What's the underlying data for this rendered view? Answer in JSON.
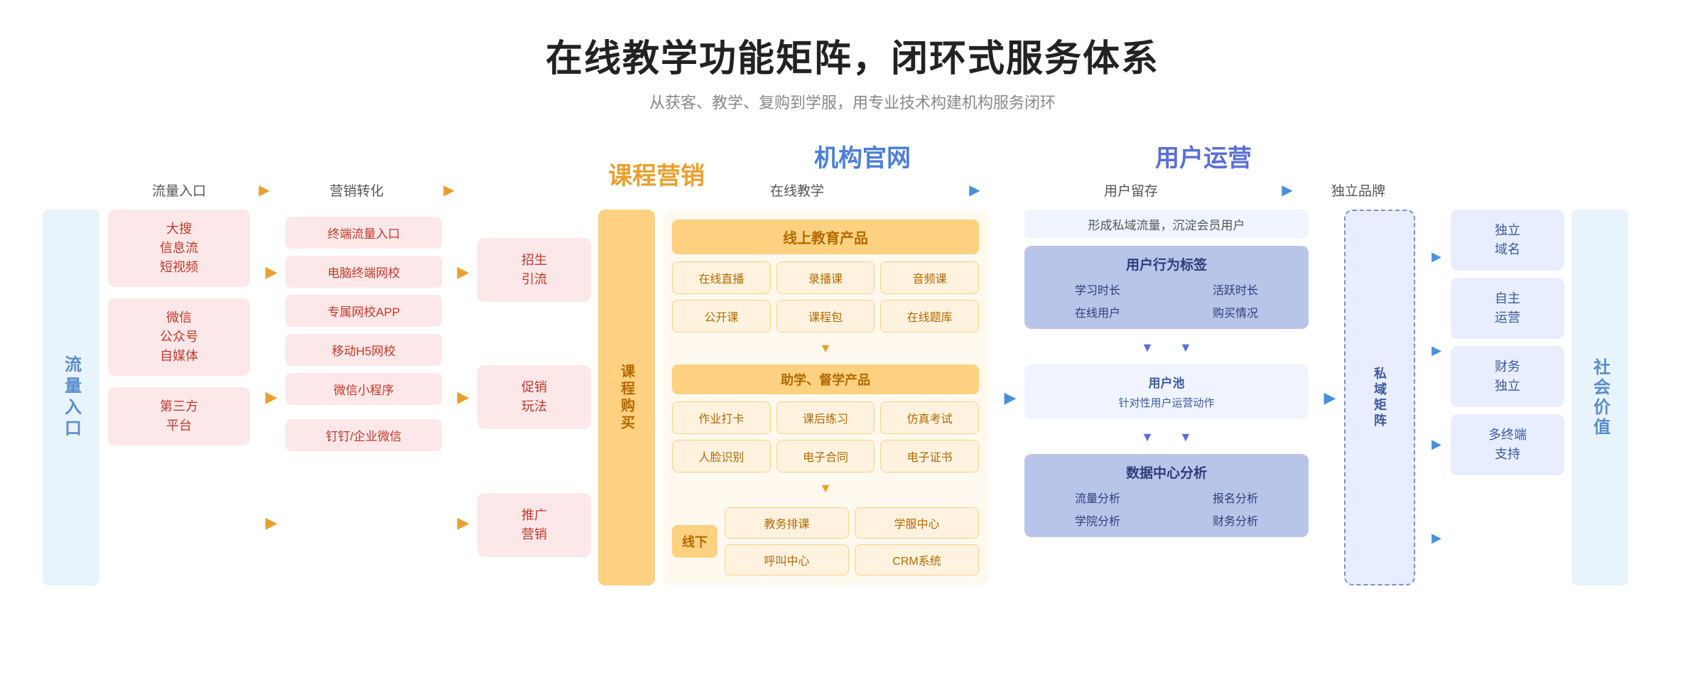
{
  "header": {
    "title": "在线教学功能矩阵，闭环式服务体系",
    "subtitle": "从获客、教学、复购到学服，用专业技术构建机构服务闭环"
  },
  "categories": {
    "marketing": "课程营销",
    "official": "机构官网",
    "user_ops": "用户运营"
  },
  "flow_labels": {
    "traffic_entry": "流量入口",
    "arrow1": "▶",
    "marketing_conv": "营销转化",
    "arrow2": "▶",
    "online_teaching": "在线教学",
    "arrow3": "▶",
    "user_retain": "用户留存",
    "arrow4": "▶",
    "brand": "独立品牌"
  },
  "left_label": "流量入口",
  "right_label": "社会价值",
  "traffic_sources": [
    "大搜\n信息流\n短视频",
    "微信\n公众号\n自媒体",
    "第三方\n平台"
  ],
  "mkt_items_col1": [
    "终端流量入口",
    "电脑终端网校",
    "专属网校APP",
    "移动H5网校",
    "微信小程序",
    "钉钉/企业微信"
  ],
  "mkt_items_groups": {
    "group1": [
      "终端流量入口"
    ],
    "group2": [
      "电脑终端网校",
      "专属网校APP",
      "移动H5网校",
      "微信小程序"
    ],
    "group3": [
      "钉钉/企业微信"
    ]
  },
  "promo_items": [
    {
      "label": "招生\n引流"
    },
    {
      "label": "促销\n玩法"
    },
    {
      "label": "推广\n营销"
    }
  ],
  "course_buy_label": "课程购买",
  "online_teach": {
    "section1_title": "线上教育产品",
    "section1_cells": [
      "在线直播",
      "录播课",
      "音频课",
      "公开课",
      "课程包",
      "在线题库"
    ],
    "section2_title": "助学、督学产品",
    "section2_cells": [
      "作业打卡",
      "课后练习",
      "仿真考试",
      "人脸识别",
      "电子合同",
      "电子证书"
    ],
    "offline_label": "线下",
    "offline_cells": [
      "教务排课",
      "学服中心",
      "呼叫中心",
      "CRM系统"
    ]
  },
  "user_retain": {
    "top_text": "形成私域流量，沉淀会员用户",
    "behavior_title": "用户行为标签",
    "behavior_cells": [
      "学习时长",
      "活跃时长",
      "在线用户",
      "购买情况"
    ],
    "pool_title": "用户池",
    "pool_sub": "针对性用户运营动作",
    "data_title": "数据中心分析",
    "data_cells": [
      "流量分析",
      "报名分析",
      "学院分析",
      "财务分析"
    ]
  },
  "private_matrix_label": "私域矩阵",
  "brand_items": [
    {
      "label": "独立\n域名"
    },
    {
      "label": "自主\n运营"
    },
    {
      "label": "财务\n独立"
    },
    {
      "label": "多终端\n支持"
    }
  ],
  "colors": {
    "orange": "#e8a030",
    "blue": "#4a7fd4",
    "purple": "#5b6fd6",
    "red_light": "#fce8e8",
    "red_text": "#c0392b",
    "orange_light": "#fff9f0",
    "orange_bg": "#ffd180",
    "blue_light": "#e8eeff",
    "blue_dark": "#3d5a9e"
  }
}
